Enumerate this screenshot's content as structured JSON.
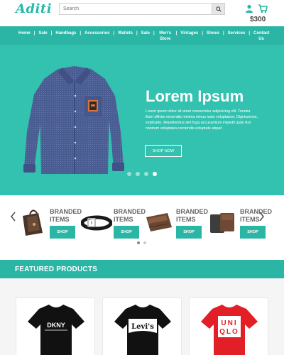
{
  "brand": {
    "logo_text": "Aditi"
  },
  "search": {
    "placeholder": "Search"
  },
  "cart": {
    "total": "$300"
  },
  "nav": {
    "items": [
      "Home",
      "Sale",
      "Handbags",
      "Accessories",
      "Wallets",
      "Sale",
      "Men's Store",
      "Vintages",
      "Shoes",
      "Services",
      "Contact Us"
    ]
  },
  "hero": {
    "title": "Lorem Ipsum",
    "text": "Lorem ipsum dolor sit amet consectetur adipisicing elit. Tenetur illum officiis reiciendis minima minus iusto voluptatum, Dignissimos, explicabo. Repellendus sint fuga accusantium impedit quia! Aut nostrum voluptates reiciendis eoluptate atque!",
    "button_label": "SHOP NOW",
    "slide_count": 4,
    "active_slide": 4
  },
  "carousel": {
    "items": [
      {
        "title": "BRANDED ITEMS",
        "button_label": "SHOP",
        "image": "bag-image"
      },
      {
        "title": "BRANDED ITEMS",
        "button_label": "SHOP",
        "image": "belt-image"
      },
      {
        "title": "BRANDED ITEMS",
        "button_label": "SHOP",
        "image": "wallet-image"
      },
      {
        "title": "BRANDED ITEMS",
        "button_label": "SHOP",
        "image": "wallet-image"
      }
    ],
    "page_count": 2,
    "active_page": 1
  },
  "featured": {
    "title": "FEATURED PRODUCTS",
    "products": [
      {
        "brand_print": "DKNY",
        "shirt_color": "#111111"
      },
      {
        "brand_print": "Levi's",
        "shirt_color": "#111111"
      },
      {
        "brand_print": "UNIQLO",
        "shirt_color": "#e21f26"
      }
    ]
  },
  "colors": {
    "accent": "#2ab5a5",
    "hero_bg": "#34c2b0",
    "shirt_blue": "#4a5d93"
  }
}
